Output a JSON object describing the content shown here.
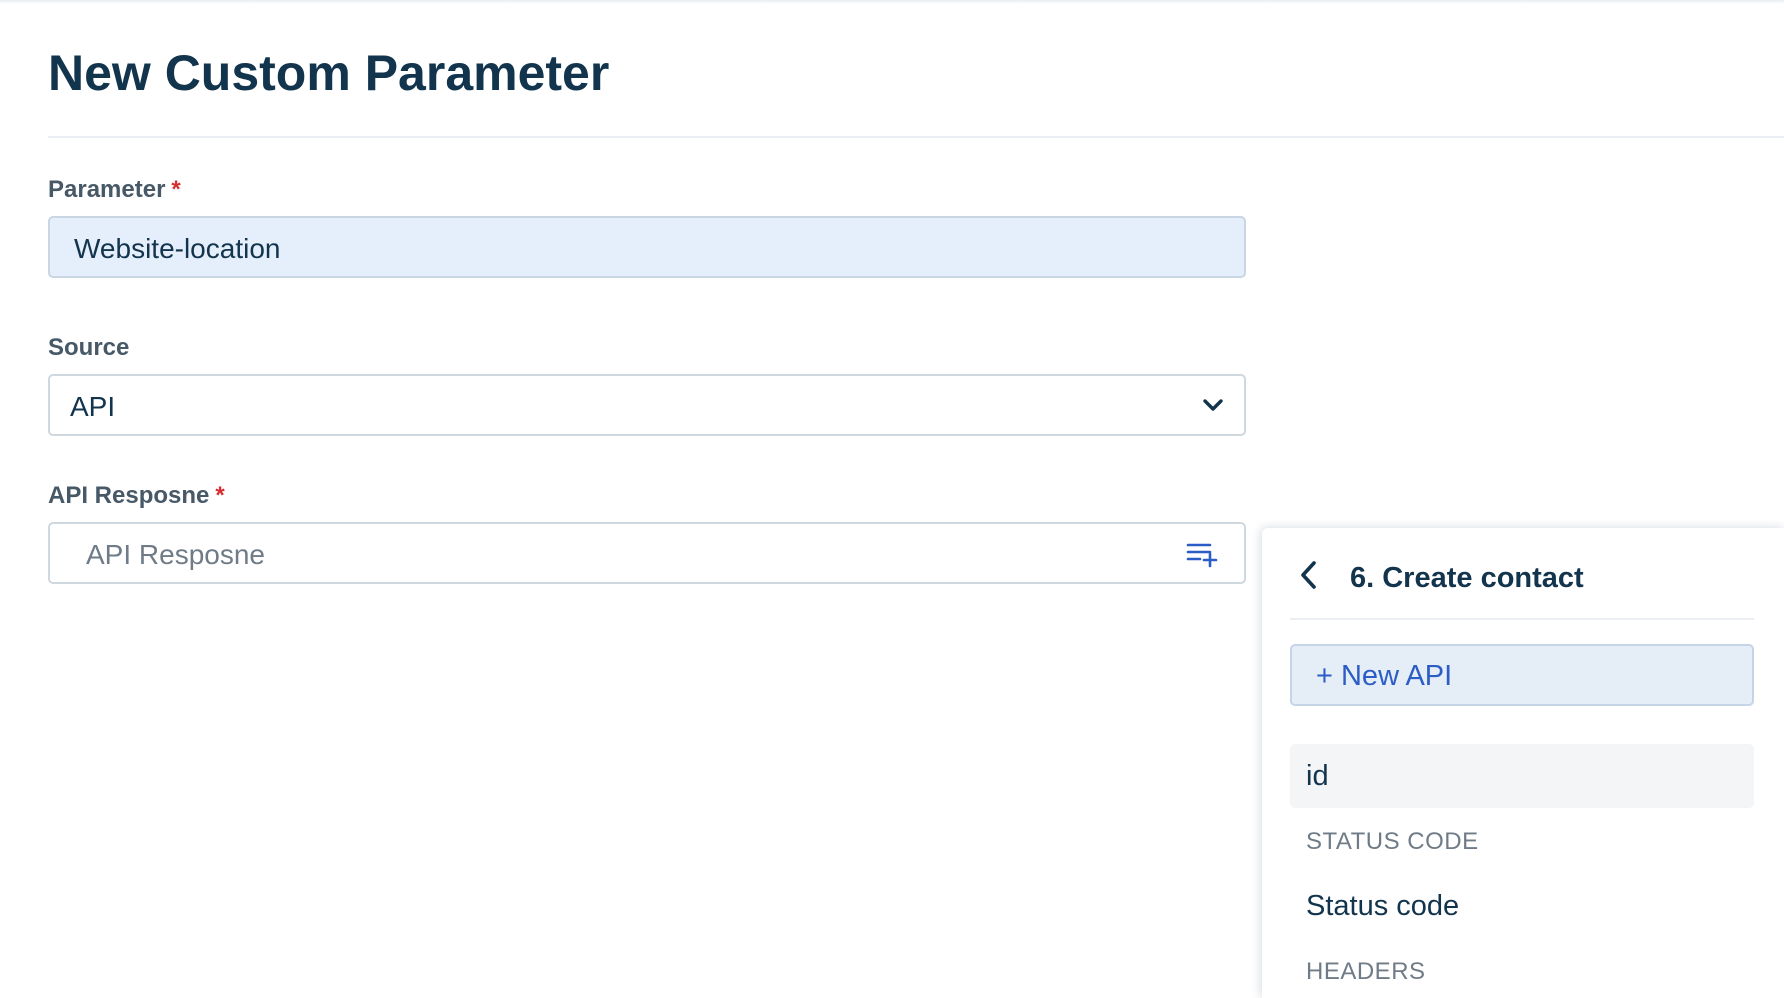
{
  "page": {
    "title": "New Custom Parameter"
  },
  "form": {
    "parameter": {
      "label": "Parameter",
      "required_mark": "*",
      "value": "Website-location"
    },
    "source": {
      "label": "Source",
      "selected": "API"
    },
    "api_response": {
      "label": "API Resposne",
      "required_mark": "*",
      "placeholder": "API Resposne"
    }
  },
  "picker": {
    "title": "6. Create contact",
    "new_api_label": "+ New API",
    "items": [
      {
        "type": "item",
        "label": "id"
      },
      {
        "type": "section",
        "label": "STATUS CODE"
      },
      {
        "type": "item",
        "label": "Status code"
      },
      {
        "type": "section",
        "label": "HEADERS"
      }
    ]
  },
  "colors": {
    "primary_text": "#12344d",
    "accent_blue": "#2c5cc5",
    "required_red": "#d72d30",
    "filled_input_bg": "#e5effb"
  },
  "icons": {
    "source_dropdown": "chevron-down-icon",
    "api_response_picker": "playlist-add-icon",
    "picker_back": "chevron-left-icon"
  }
}
